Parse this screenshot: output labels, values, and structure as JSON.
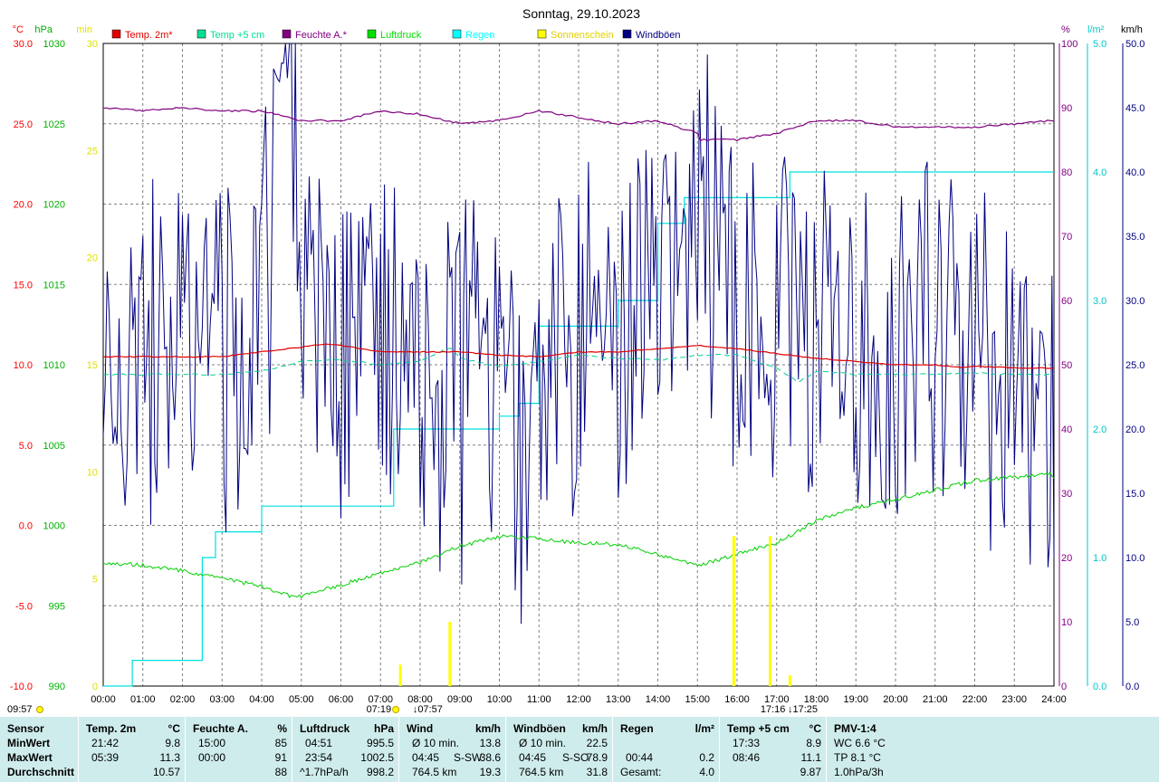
{
  "title": "Sonntag, 29.10.2023",
  "axes": {
    "temp": {
      "unit": "°C",
      "ticks": [
        "30.0",
        "25.0",
        "20.0",
        "15.0",
        "10.0",
        "5.0",
        "0.0",
        "-5.0",
        "-10.0"
      ],
      "color": "#ff0000"
    },
    "pressure": {
      "unit": "hPa",
      "ticks": [
        "1030",
        "1025",
        "1020",
        "1015",
        "1010",
        "1005",
        "1000",
        "995",
        "990"
      ],
      "color": "#00b000"
    },
    "sunshine": {
      "unit": "min",
      "ticks": [
        "30",
        "25",
        "20",
        "15",
        "10",
        "5",
        "0"
      ],
      "color": "#e0e000"
    },
    "humidity": {
      "unit": "%",
      "ticks": [
        "100",
        "90",
        "80",
        "70",
        "60",
        "50",
        "40",
        "30",
        "20",
        "10",
        "0"
      ],
      "color": "#800080"
    },
    "rain": {
      "unit": "l/m²",
      "ticks": [
        "5.0",
        "4.0",
        "3.0",
        "2.0",
        "1.0",
        "0.0"
      ],
      "color": "#00c8c8"
    },
    "wind": {
      "unit": "km/h",
      "ticks": [
        "50.0",
        "45.0",
        "40.0",
        "35.0",
        "30.0",
        "25.0",
        "20.0",
        "15.0",
        "10.0",
        "5.0",
        "0.0"
      ],
      "color": "#000080"
    },
    "time_ticks": [
      "00:00",
      "01:00",
      "02:00",
      "03:00",
      "04:00",
      "05:00",
      "06:00",
      "07:00",
      "08:00",
      "09:00",
      "10:00",
      "11:00",
      "12:00",
      "13:00",
      "14:00",
      "15:00",
      "16:00",
      "17:00",
      "18:00",
      "19:00",
      "20:00",
      "21:00",
      "22:00",
      "23:00",
      "24:00"
    ]
  },
  "legend": [
    {
      "label": "Temp. 2m*",
      "color": "#e00000"
    },
    {
      "label": "Temp +5 cm",
      "color": "#00e090"
    },
    {
      "label": "Feuchte A.*",
      "color": "#800080"
    },
    {
      "label": "Luftdruck",
      "color": "#00e000"
    },
    {
      "label": "Regen",
      "color": "#00ffff"
    },
    {
      "label": "Sonnenschein",
      "color": "#ffff00"
    },
    {
      "label": "Windböen",
      "color": "#000080"
    }
  ],
  "sun_markers": {
    "left_time": "09:57",
    "sunrise": "07:19",
    "dawn": "07:57",
    "sunset": "17:16",
    "dusk": "17:25"
  },
  "chart_data": {
    "type": "line",
    "title": "Sonntag, 29.10.2023",
    "x_range": [
      "00:00",
      "24:00"
    ],
    "series": [
      {
        "name": "Temp. 2m*",
        "unit": "°C",
        "x": [
          "00:00",
          "01:00",
          "02:00",
          "03:00",
          "04:00",
          "05:00",
          "05:39",
          "06:00",
          "07:00",
          "08:00",
          "09:00",
          "10:00",
          "11:00",
          "12:00",
          "13:00",
          "14:00",
          "15:00",
          "16:00",
          "17:00",
          "18:00",
          "19:00",
          "20:00",
          "21:00",
          "21:42",
          "22:00",
          "23:00",
          "24:00"
        ],
        "y": [
          10.5,
          10.5,
          10.5,
          10.5,
          10.8,
          11.1,
          11.3,
          11.2,
          10.8,
          10.8,
          10.8,
          10.6,
          10.5,
          10.8,
          10.8,
          11.0,
          11.2,
          11.0,
          10.7,
          10.4,
          10.2,
          10.0,
          10.0,
          9.8,
          9.9,
          9.8,
          9.8
        ]
      },
      {
        "name": "Temp +5 cm",
        "unit": "°C",
        "x": [
          "00:00",
          "01:00",
          "02:00",
          "03:00",
          "04:00",
          "05:00",
          "06:00",
          "07:00",
          "08:00",
          "08:46",
          "09:00",
          "10:00",
          "11:00",
          "12:00",
          "13:00",
          "14:00",
          "15:00",
          "16:00",
          "17:00",
          "17:33",
          "18:00",
          "19:00",
          "20:00",
          "21:00",
          "22:00",
          "23:00",
          "24:00"
        ],
        "y": [
          9.4,
          9.4,
          9.4,
          9.4,
          9.6,
          10.2,
          10.3,
          10.0,
          10.2,
          11.1,
          10.4,
          9.9,
          10.2,
          10.6,
          10.4,
          10.3,
          10.6,
          10.6,
          9.8,
          8.9,
          9.6,
          9.4,
          9.4,
          9.4,
          9.5,
          9.4,
          9.4
        ]
      },
      {
        "name": "Feuchte A.*",
        "unit": "%",
        "x": [
          "00:00",
          "01:00",
          "02:00",
          "03:00",
          "04:00",
          "05:00",
          "06:00",
          "07:00",
          "08:00",
          "09:00",
          "10:00",
          "11:00",
          "12:00",
          "13:00",
          "14:00",
          "15:00",
          "15:00",
          "16:00",
          "17:00",
          "18:00",
          "19:00",
          "20:00",
          "21:00",
          "22:00",
          "23:00",
          "24:00"
        ],
        "y": [
          90,
          89.5,
          90,
          89.5,
          89.5,
          88,
          88,
          89.5,
          89,
          87.5,
          88,
          89.5,
          88.5,
          87.5,
          88,
          86,
          85,
          85,
          86,
          88,
          88,
          87,
          87,
          87,
          87.5,
          88
        ]
      },
      {
        "name": "Luftdruck",
        "unit": "hPa",
        "x": [
          "00:00",
          "01:00",
          "02:00",
          "03:00",
          "04:00",
          "04:51",
          "06:00",
          "07:00",
          "08:00",
          "09:00",
          "10:00",
          "11:00",
          "12:00",
          "13:00",
          "14:00",
          "15:00",
          "16:00",
          "17:00",
          "18:00",
          "19:00",
          "20:00",
          "21:00",
          "22:00",
          "23:00",
          "23:54",
          "24:00"
        ],
        "y": [
          997.7,
          997.5,
          997.2,
          996.7,
          996.2,
          995.5,
          996.3,
          997.0,
          997.7,
          998.7,
          999.3,
          999.2,
          998.9,
          998.8,
          998.2,
          997.5,
          998.2,
          998.9,
          1000.3,
          1001.1,
          1001.6,
          1002.2,
          1002.8,
          1003.0,
          1003.2,
          1003.0
        ]
      },
      {
        "name": "Regen",
        "unit": "l/m²",
        "x": [
          "00:00",
          "00:44",
          "02:15",
          "02:30",
          "02:50",
          "03:00",
          "04:00",
          "05:00",
          "06:00",
          "07:00",
          "07:20",
          "08:00",
          "09:00",
          "10:00",
          "10:30",
          "11:00",
          "12:00",
          "13:00",
          "13:30",
          "14:00",
          "14:40",
          "15:00",
          "16:00",
          "17:00",
          "17:20",
          "18:00",
          "24:00"
        ],
        "y": [
          0.0,
          0.2,
          0.2,
          1.0,
          1.2,
          1.2,
          1.4,
          1.4,
          1.4,
          1.4,
          2.0,
          2.0,
          2.0,
          2.1,
          2.2,
          2.8,
          2.8,
          3.0,
          3.0,
          3.6,
          3.8,
          3.8,
          3.8,
          3.8,
          4.0,
          4.0,
          4.0
        ]
      },
      {
        "name": "Windböen",
        "unit": "km/h",
        "x": [
          "00:00",
          "01:00",
          "02:00",
          "03:00",
          "04:00",
          "04:45",
          "05:00",
          "06:00",
          "07:00",
          "08:00",
          "09:00",
          "10:00",
          "10:40",
          "11:00",
          "12:00",
          "13:00",
          "14:00",
          "15:00",
          "16:00",
          "17:00",
          "18:00",
          "19:00",
          "20:00",
          "21:00",
          "22:00",
          "23:00",
          "24:00"
        ],
        "y": [
          27.0,
          25.0,
          25.0,
          26.0,
          29.0,
          50.0,
          28.0,
          27.0,
          27.5,
          25.0,
          23.0,
          24.0,
          15.0,
          25.0,
          26.0,
          27.0,
          33.0,
          37.0,
          30.0,
          29.0,
          28.0,
          25.0,
          27.0,
          26.0,
          25.0,
          21.0,
          21.0
        ]
      },
      {
        "name": "Sonnenschein",
        "unit": "min",
        "x": [
          "07:30",
          "08:45",
          "15:55",
          "16:50",
          "17:20"
        ],
        "y": [
          1.0,
          3.0,
          7.0,
          7.0,
          0.5
        ]
      }
    ]
  },
  "stats": {
    "sensor": {
      "title": "Sensor",
      "min": "MinWert",
      "max": "MaxWert",
      "avg": "Durchschnitt"
    },
    "temp2m": {
      "title": "Temp. 2m",
      "unit": "°C",
      "min_time": "21:42",
      "min_val": "9.8",
      "max_time": "05:39",
      "max_val": "11.3",
      "avg_val": "10.57"
    },
    "humidity": {
      "title": "Feuchte A.",
      "unit": "%",
      "min_time": "15:00",
      "min_val": "85",
      "max_time": "00:00",
      "max_val": "91",
      "avg_val": "88"
    },
    "pressure": {
      "title": "Luftdruck",
      "unit": "hPa",
      "min_time": "04:51",
      "min_val": "995.5",
      "max_time": "23:54",
      "max_val": "1002.5",
      "trend": "^1.7hPa/h",
      "avg_val": "998.2"
    },
    "wind": {
      "title": "Wind",
      "unit": "km/h",
      "r1_label": "Ø 10 min.",
      "r1_val": "13.8",
      "r2_time": "04:45",
      "r2_dir": "S-SW",
      "r2_val": "38.6",
      "r3_dist": "764.5 km",
      "r3_val": "19.3"
    },
    "gusts": {
      "title": "Windböen",
      "unit": "km/h",
      "r1_label": "Ø 10 min.",
      "r1_val": "22.5",
      "r2_time": "04:45",
      "r2_dir": "S-SO",
      "r2_val": "78.9",
      "r3_dist": "764.5 km",
      "r3_val": "31.8"
    },
    "rain": {
      "title": "Regen",
      "unit": "l/m²",
      "r2_time": "00:44",
      "r2_val": "0.2",
      "r3_label": "Gesamt:",
      "r3_val": "4.0"
    },
    "temp5cm": {
      "title": "Temp +5 cm",
      "unit": "°C",
      "min_time": "17:33",
      "min_val": "8.9",
      "max_time": "08:46",
      "max_val": "11.1",
      "avg_val": "9.87"
    },
    "pmv": {
      "title": "PMV-1:4",
      "r1": "WC 6.6 °C",
      "r2": "TP 8.1 °C",
      "r3": "1.0hPa/3h"
    }
  }
}
